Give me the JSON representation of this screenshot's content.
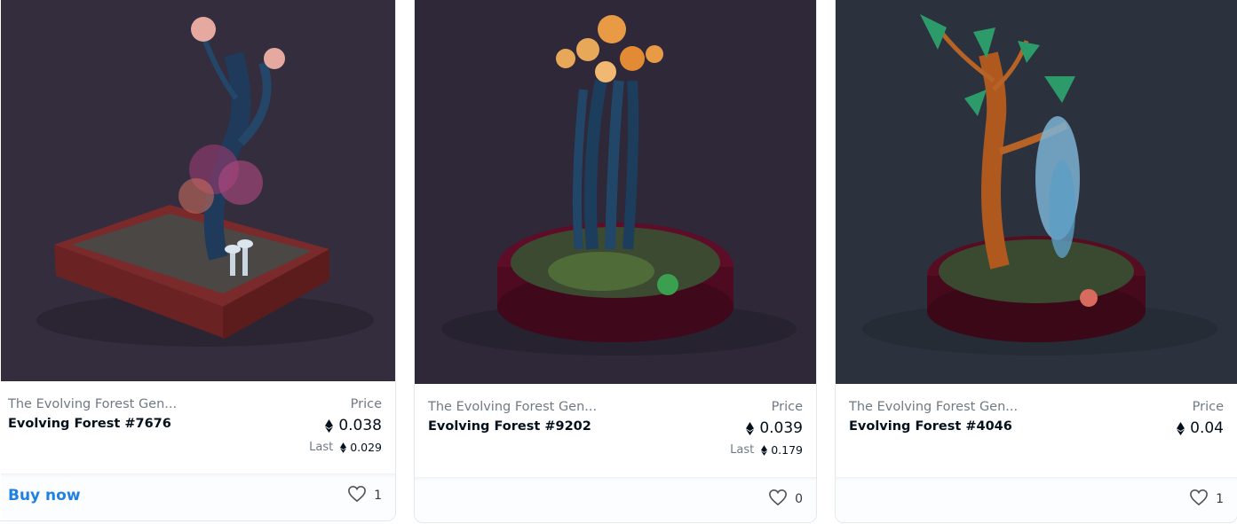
{
  "cards": [
    {
      "collection": "The Evolving Forest Gen...",
      "name": "Evolving Forest #7676",
      "price_label": "Price",
      "price": "0.038",
      "last_label": "Last",
      "last_price": "0.029",
      "buy_now": "Buy now",
      "likes": "1",
      "art_bg": "#332d3e",
      "pot_color": "#7a2a2a"
    },
    {
      "collection": "The Evolving Forest Gen...",
      "name": "Evolving Forest #9202",
      "price_label": "Price",
      "price": "0.039",
      "last_label": "Last",
      "last_price": "0.179",
      "likes": "0",
      "art_bg": "#2e2839",
      "pot_color": "#5e0d28"
    },
    {
      "collection": "The Evolving Forest Gen...",
      "name": "Evolving Forest #4046",
      "price_label": "Price",
      "price": "0.04",
      "likes": "1",
      "art_bg": "#2b323d",
      "pot_color": "#560d22"
    }
  ],
  "colors": {
    "accent": "#2081e2",
    "muted_text": "#707a83",
    "primary_text": "#04111d"
  },
  "icons": {
    "currency": "ethereum-icon",
    "favorite": "heart-outline-icon"
  }
}
